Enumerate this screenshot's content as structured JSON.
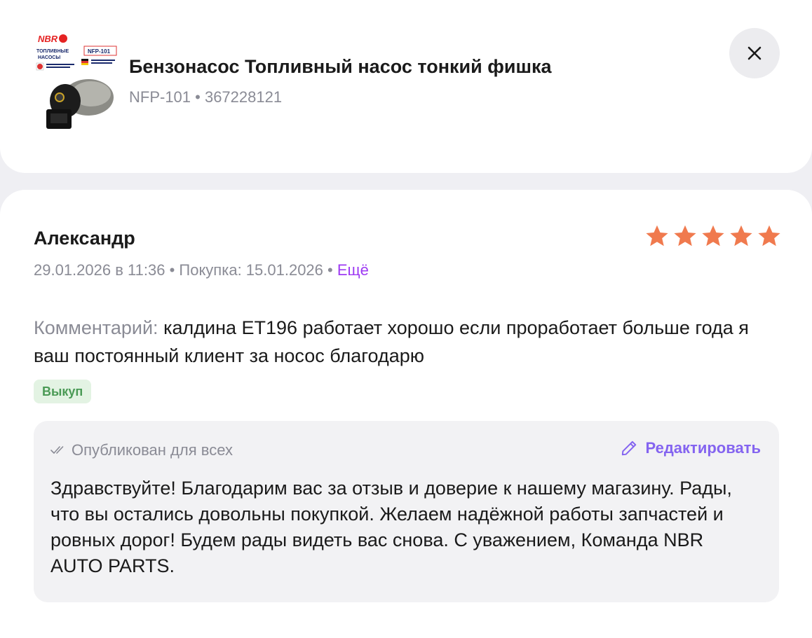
{
  "product": {
    "title": "Бензонасос Топливный насос тонкий фишка",
    "subtitle": "NFP-101 • 367228121",
    "image": {
      "brand": "NBR",
      "text_line1": "ТОПЛИВНЫЕ",
      "text_line2": "НАСОСЫ",
      "part_code": "NFP-101"
    }
  },
  "close_icon": "close-icon",
  "review": {
    "author": "Александр",
    "rating": 5,
    "date": "29.01.2026 в 11:36",
    "purchase": "Покупка: 15.01.2026",
    "separator": " • ",
    "more_link": "Ещё",
    "comment_label": "Комментарий:",
    "comment_text": "калдина ET196 работает хорошо если проработает больше года я ваш постоянный клиент за носос благодарю",
    "badge": "Выкуп"
  },
  "reply": {
    "status": "Опубликован для всех",
    "edit_label": "Редактировать",
    "text": "Здравствуйте! Благодарим вас за отзыв и доверие к нашему магазину. Рады, что вы остались довольны покупкой. Желаем надёжной работы запчастей и ровных дорог! Будем рады видеть вас снова. С уважением, Команда NBR AUTO PARTS."
  },
  "colors": {
    "star": "#f07a4e",
    "accent_link": "#9e3af3",
    "edit": "#8464f0",
    "badge_bg": "#e3f3e3",
    "badge_text": "#4a9a55"
  }
}
